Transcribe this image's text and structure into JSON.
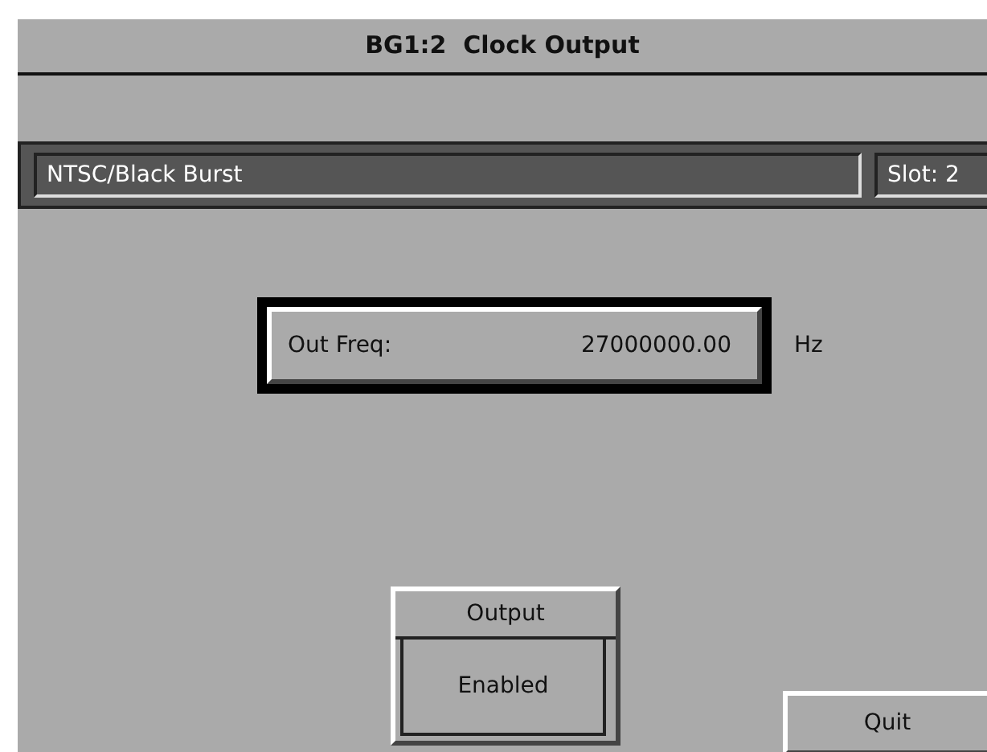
{
  "window": {
    "title": "BG1:2  Clock Output"
  },
  "info_bar": {
    "standard": "NTSC/Black Burst",
    "slot": "Slot: 2"
  },
  "frequency": {
    "label": "Out Freq:",
    "value": "27000000.00",
    "unit": "Hz",
    "focused": true
  },
  "output": {
    "label": "Output",
    "value": "Enabled"
  },
  "buttons": [
    {
      "label": "Quit"
    }
  ]
}
